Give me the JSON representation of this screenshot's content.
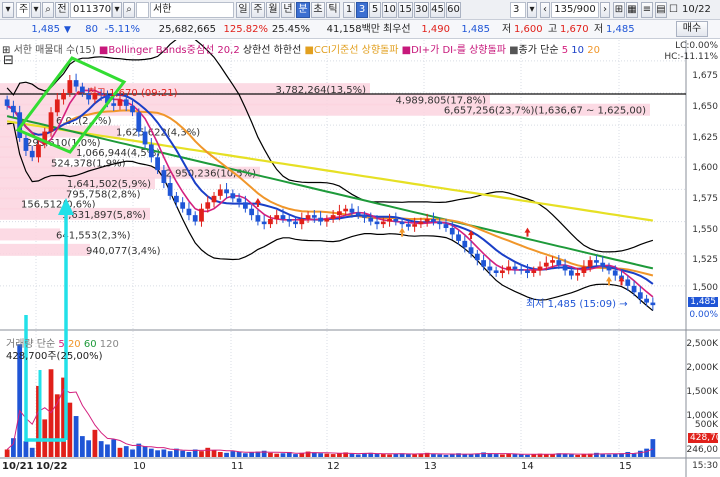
{
  "toolbar1": {
    "menu_arrow": "▾",
    "market": "주",
    "market_dd": "▾",
    "search_icon": "⌕",
    "prev_btn": "전",
    "code": "011370",
    "code_dd": "▾",
    "search_btn_icon": "⌕",
    "name_badge": "신",
    "name": "서한",
    "periods": [
      "일",
      "주",
      "월",
      "년",
      "분",
      "초",
      "틱"
    ],
    "active_period": "분",
    "minutes": [
      "1",
      "3",
      "5",
      "10",
      "15",
      "30",
      "45",
      "60"
    ],
    "active_minute": "3",
    "interval": "3",
    "count": "135/900",
    "date": "10/22"
  },
  "toolbar2": {
    "price": "1,485",
    "change_arrow": "▼",
    "change": "80",
    "change_pct": "-5.11%",
    "volume": "25,682,665",
    "vol_ratio": "125.82%",
    "turnover": "25.45%",
    "amount": "41,158백만",
    "pref_label": "최우선",
    "ask": "1,490",
    "bid": "1,485",
    "low_label": "저",
    "low_val": "1,600",
    "high_label": "고",
    "high_val": "1,670",
    "low2_label": "저",
    "low2_val": "1,485",
    "buy_btn": "매수"
  },
  "legend": {
    "volume_profile": "서한 매물대 수(15)",
    "bollinger": "Bollinger Bands중심선 20,2",
    "upper": "상한선",
    "lower": "하한선",
    "cci": "CCI기준선 상향돌파",
    "di": "DI+가 DI-를 상향돌파",
    "ma": "종가 단순",
    "ma5": "5",
    "ma10": "10",
    "ma20": "20"
  },
  "price_axis": {
    "labels": [
      "LC:0.00%",
      "HC:-11.11%",
      "1,675",
      "1,650",
      "1,625",
      "1,600",
      "1,575",
      "1,550",
      "1,525",
      "1,500",
      "1,485",
      "0.00%"
    ],
    "current_tag": "1,485"
  },
  "volume_profile": [
    {
      "text": "3,782,264(13,5%)"
    },
    {
      "text": "4,989,805(17,8%)"
    },
    {
      "text": "6,657,256(23,7%)(1,636,67 ~ 1,625,00)"
    },
    {
      "text": "6,0..(2,..%)"
    },
    {
      "text": "1,625,622(4,3%)"
    },
    {
      "text": "293,610(1,0%)"
    },
    {
      "text": "1,066,944(4,5%)"
    },
    {
      "text": "524,378(1,9%)"
    },
    {
      "text": "2,950,236(10,5%)"
    },
    {
      "text": "1,641,502(5,9%)"
    },
    {
      "text": "795,758(2,8%)"
    },
    {
      "text": "156,512(0,6%)"
    },
    {
      "text": "1,631,897(5,8%)"
    },
    {
      "text": "641,553(2,3%)"
    },
    {
      "text": "940,077(3,4%)"
    }
  ],
  "annotations": {
    "high": "최고 1,670 (09:21)",
    "low": "최저 1,485 (15:09)"
  },
  "volume_panel": {
    "legend": "거래량 단순 5  20  60  120",
    "legend_label": "거래량 단순",
    "ma5": "5",
    "ma20": "20",
    "ma60": "60",
    "ma120": "120",
    "sub": "428,700주(25,00%)",
    "axis": [
      "2,500K",
      "2,000K",
      "1,500K",
      "1,000K",
      "500K",
      "246,00"
    ],
    "current_tag": "428,70"
  },
  "time_axis": [
    "10/21",
    "10/22",
    "10",
    "11",
    "12",
    "13",
    "14",
    "15"
  ],
  "time_end": "15:30",
  "colors": {
    "up": "#e0201a",
    "down": "#1f55d6",
    "ma5": "#d4207e",
    "ma10": "#1a3fc7",
    "ma20": "#f0962a",
    "ma60": "#1e9a3a",
    "ma120": "#e6e024",
    "bollinger": "#000000",
    "annot_green": "#33dd33",
    "annot_cyan": "#22e0e8"
  },
  "chart_data": {
    "type": "candlestick",
    "title": "서한",
    "y_range": [
      1475,
      1685
    ],
    "high": 1670,
    "low": 1485,
    "last": 1485,
    "close_approx": [
      1640,
      1635,
      1615,
      1605,
      1600,
      1610,
      1620,
      1635,
      1645,
      1650,
      1660,
      1655,
      1650,
      1645,
      1650,
      1648,
      1642,
      1640,
      1645,
      1640,
      1635,
      1620,
      1610,
      1600,
      1590,
      1580,
      1570,
      1565,
      1560,
      1555,
      1550,
      1560,
      1565,
      1570,
      1575,
      1572,
      1568,
      1565,
      1560,
      1555,
      1550,
      1548,
      1552,
      1555,
      1552,
      1550,
      1548,
      1552,
      1555,
      1553,
      1550,
      1552,
      1555,
      1558,
      1560,
      1557,
      1555,
      1553,
      1550,
      1548,
      1550,
      1552,
      1550,
      1548,
      1546,
      1548,
      1550,
      1552,
      1550,
      1548,
      1545,
      1540,
      1535,
      1530,
      1525,
      1520,
      1515,
      1512,
      1510,
      1512,
      1515,
      1513,
      1512,
      1510,
      1512,
      1515,
      1518,
      1520,
      1516,
      1512,
      1508,
      1510,
      1515,
      1520,
      1518,
      1515,
      1512,
      1508,
      1505,
      1500,
      1495,
      1490,
      1487,
      1485
    ],
    "volume_k_approx": [
      180,
      450,
      2700,
      380,
      220,
      1700,
      900,
      2100,
      1500,
      1900,
      1300,
      980,
      500,
      400,
      650,
      380,
      300,
      420,
      220,
      260,
      180,
      320,
      260,
      200,
      160,
      180,
      140,
      200,
      150,
      120,
      180,
      140,
      220,
      160,
      120,
      100,
      140,
      120,
      90,
      110,
      130,
      150,
      100,
      80,
      90,
      120,
      70,
      100,
      130,
      110,
      90,
      80,
      70,
      90,
      110,
      80,
      60,
      90,
      100,
      80,
      70,
      60,
      80,
      90,
      70,
      60,
      80,
      100,
      70,
      60,
      50,
      80,
      90,
      70,
      60,
      80,
      110,
      90,
      70,
      60,
      80,
      70,
      60,
      50,
      70,
      80,
      60,
      70,
      90,
      80,
      60,
      50,
      70,
      80,
      100,
      70,
      60,
      80,
      90,
      120,
      80,
      150,
      200,
      428
    ]
  }
}
